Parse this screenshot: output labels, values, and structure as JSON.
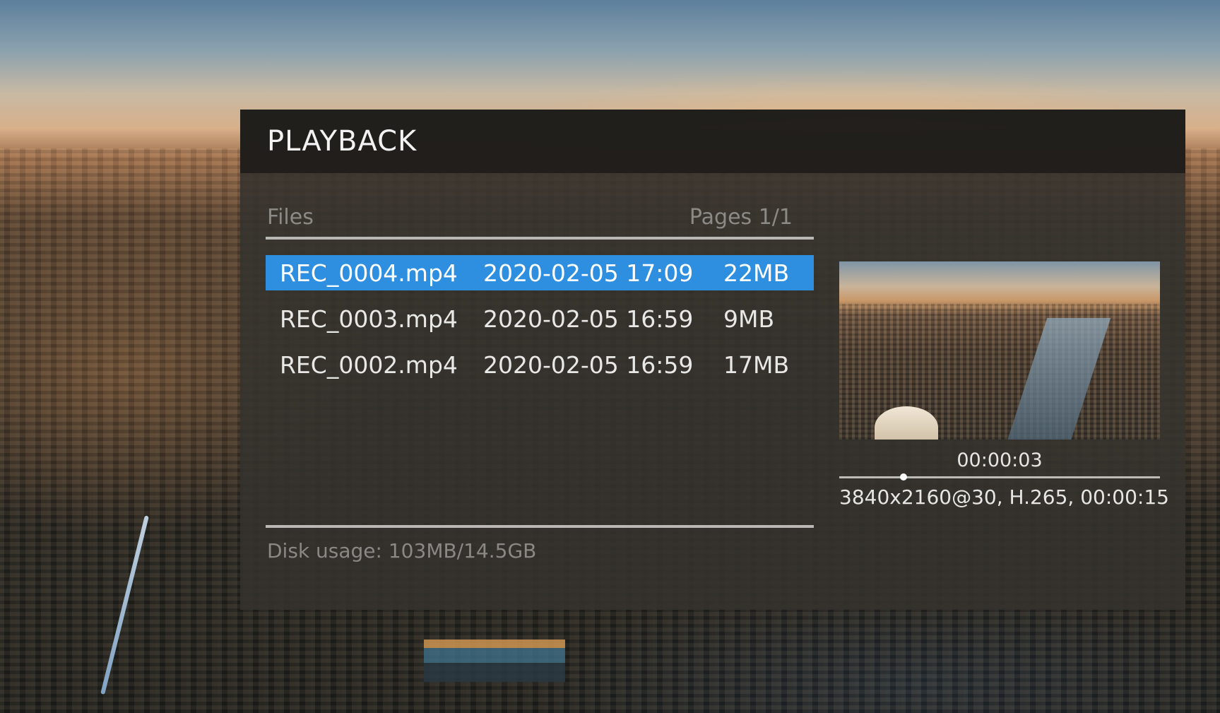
{
  "dialog": {
    "title": "PLAYBACK"
  },
  "file_list": {
    "header_label": "Files",
    "pages": "Pages 1/1",
    "files": [
      {
        "name": "REC_0004.mp4",
        "date": "2020-02-05 17:09",
        "size": "22MB",
        "selected": true
      },
      {
        "name": "REC_0003.mp4",
        "date": "2020-02-05 16:59",
        "size": "9MB",
        "selected": false
      },
      {
        "name": "REC_0002.mp4",
        "date": "2020-02-05 16:59",
        "size": "17MB",
        "selected": false
      }
    ],
    "disk_usage": "Disk usage: 103MB/14.5GB"
  },
  "preview": {
    "current_time": "00:00:03",
    "progress_fraction": 0.2,
    "info": "3840x2160@30, H.265, 00:00:15"
  },
  "colors": {
    "selection": "#2e8fe0",
    "header_bar": "#1e1c1a",
    "panel": "#34322e"
  }
}
